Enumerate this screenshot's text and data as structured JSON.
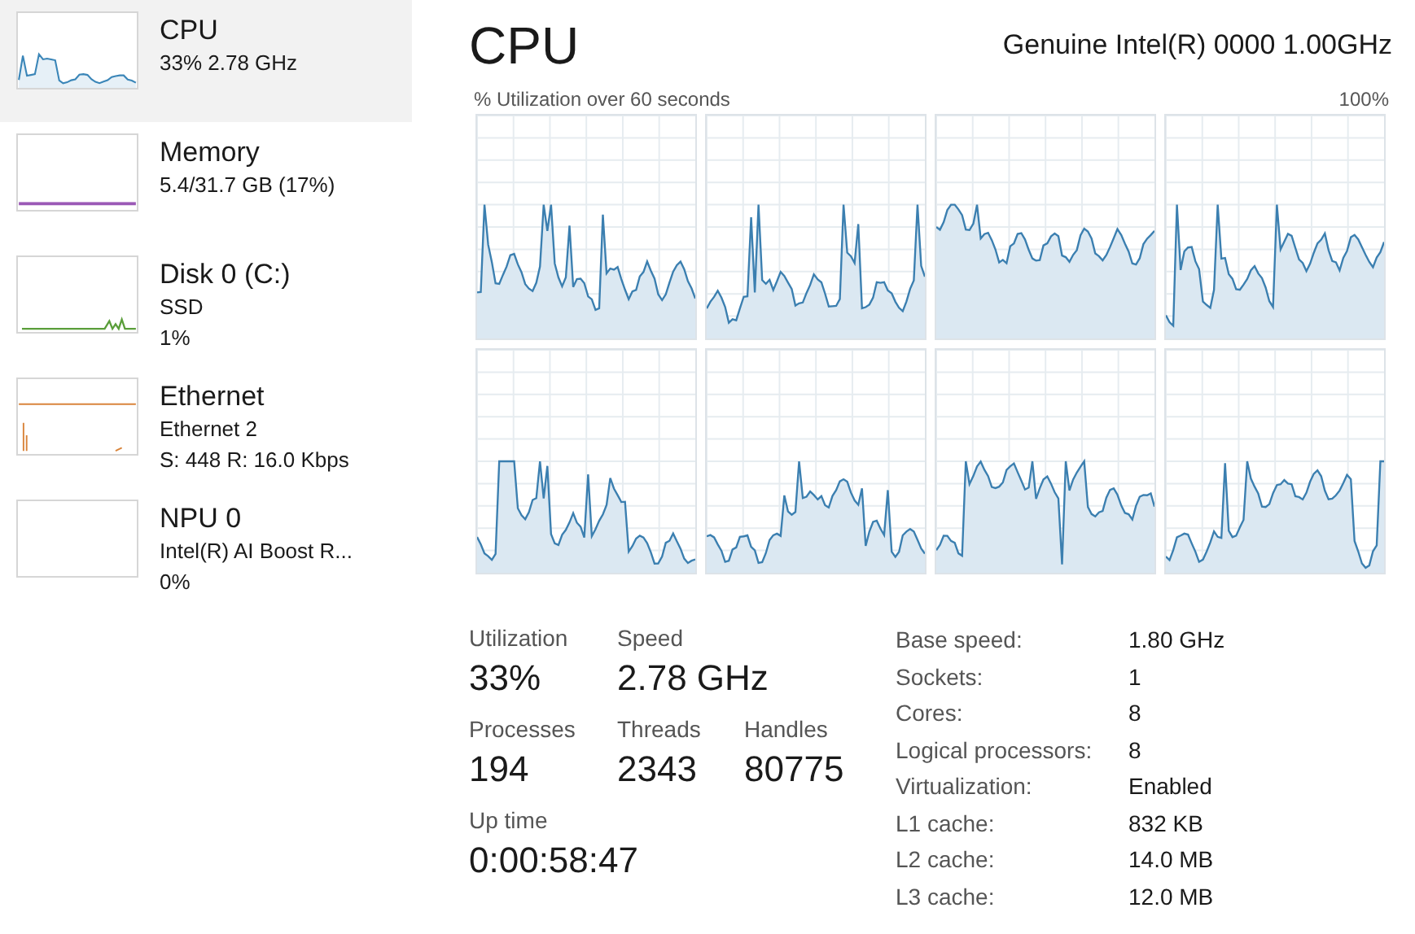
{
  "sidebar": {
    "items": [
      {
        "kind": "cpu",
        "name": "CPU",
        "lines": [
          "33% 2.78 GHz"
        ],
        "color": "#3b86b8",
        "selected": true
      },
      {
        "kind": "memory",
        "name": "Memory",
        "lines": [
          "5.4/31.7 GB (17%)"
        ],
        "color": "#9b59b6",
        "selected": false
      },
      {
        "kind": "disk",
        "name": "Disk 0 (C:)",
        "lines": [
          "SSD",
          "1%"
        ],
        "color": "#5a9e3a",
        "selected": false
      },
      {
        "kind": "ethernet",
        "name": "Ethernet",
        "lines": [
          "Ethernet 2",
          "S: 448 R: 16.0 Kbps"
        ],
        "color": "#d9843b",
        "selected": false
      },
      {
        "kind": "npu",
        "name": "NPU 0",
        "lines": [
          "Intel(R) AI Boost  R...",
          "0%"
        ],
        "selected": false
      }
    ]
  },
  "header": {
    "title": "CPU",
    "processor": "Genuine Intel(R) 0000 1.00GHz"
  },
  "graph": {
    "caption": "% Utilization over 60 seconds",
    "max_label": "100%"
  },
  "stat_rows": [
    [
      {
        "label": "Utilization",
        "value": "33%"
      },
      {
        "label": "Speed",
        "value": "2.78 GHz"
      }
    ],
    [
      {
        "label": "Processes",
        "value": "194"
      },
      {
        "label": "Threads",
        "value": "2343"
      },
      {
        "label": "Handles",
        "value": "80775"
      }
    ],
    [
      {
        "label": "Up time",
        "value": "0:00:58:47"
      }
    ]
  ],
  "details": [
    {
      "label": "Base speed:",
      "value": "1.80 GHz"
    },
    {
      "label": "Sockets:",
      "value": "1"
    },
    {
      "label": "Cores:",
      "value": "8"
    },
    {
      "label": "Logical processors:",
      "value": "8"
    },
    {
      "label": "Virtualization:",
      "value": "Enabled"
    },
    {
      "label": "L1 cache:",
      "value": "832 KB"
    },
    {
      "label": "L2 cache:",
      "value": "14.0 MB"
    },
    {
      "label": "L3 cache:",
      "value": "12.0 MB"
    }
  ]
}
